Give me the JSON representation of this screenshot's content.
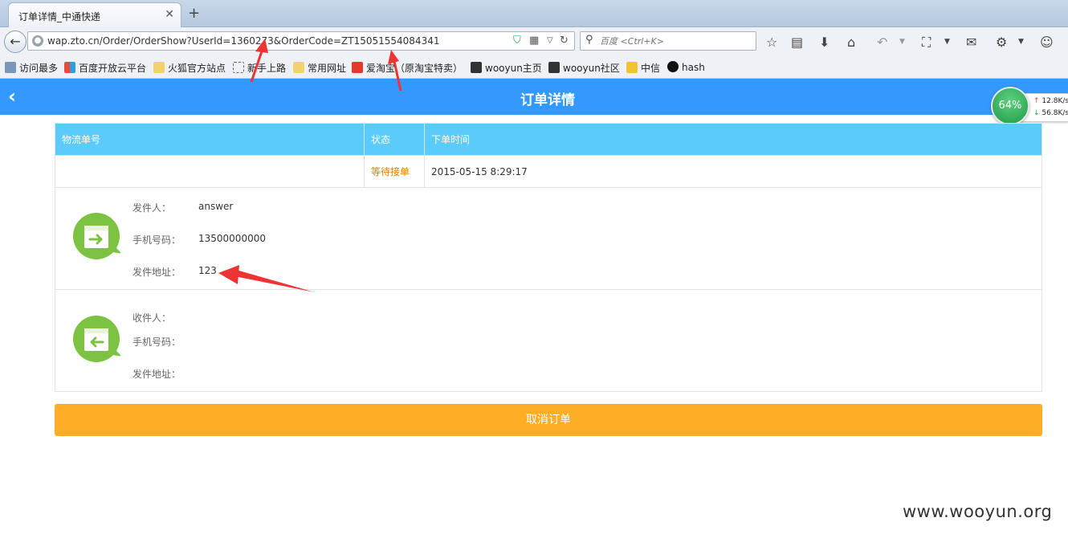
{
  "browser": {
    "tab_title": "订单详情_中通快递",
    "url": "wap.zto.cn/Order/OrderShow?UserId=1360273&OrderCode=ZT15051554084341",
    "search_placeholder": "百度 <Ctrl+K>",
    "bookmarks": [
      {
        "label": "访问最多",
        "icon": "frequent-icon"
      },
      {
        "label": "百度开放云平台",
        "icon": "windows-tiles-icon"
      },
      {
        "label": "火狐官方站点",
        "icon": "folder-icon"
      },
      {
        "label": "新手上路",
        "icon": "dashed-page-icon"
      },
      {
        "label": "常用网址",
        "icon": "folder-icon"
      },
      {
        "label": "爱淘宝（原淘宝特卖）",
        "icon": "taobao-icon"
      },
      {
        "label": "wooyun主页",
        "icon": "wooyun-icon"
      },
      {
        "label": "wooyun社区",
        "icon": "wooyun-icon"
      },
      {
        "label": "中信",
        "icon": "citic-icon"
      },
      {
        "label": "hash",
        "icon": "hash-icon"
      }
    ]
  },
  "page": {
    "title": "订单详情",
    "table": {
      "headers": [
        "物流单号",
        "状态",
        "下单时间"
      ],
      "row": {
        "tracking_no": "",
        "status": "等待接单",
        "time": "2015-05-15 8:29:17"
      }
    },
    "sender": {
      "labels": {
        "name": "发件人：",
        "phone": "手机号码：",
        "address": "发件地址："
      },
      "values": {
        "name": "answer",
        "phone": "13500000000",
        "address": "123"
      }
    },
    "receiver": {
      "labels": {
        "name": "收件人：",
        "phone": "手机号码：",
        "address": "发件地址："
      },
      "values": {
        "name": "",
        "phone": "",
        "address": ""
      }
    },
    "cancel_label": "取消订单"
  },
  "widget": {
    "percent": "64%",
    "up": "12.8K/s",
    "down": "56.8K/s"
  },
  "watermark": "www.wooyun.org",
  "colors": {
    "app_bar": "#3399ff",
    "table_header": "#5bcbfc",
    "status": "#e07e00",
    "cancel_button": "#fdad26",
    "box_icon": "#7dc243",
    "annotation_arrow": "#ee3333"
  }
}
